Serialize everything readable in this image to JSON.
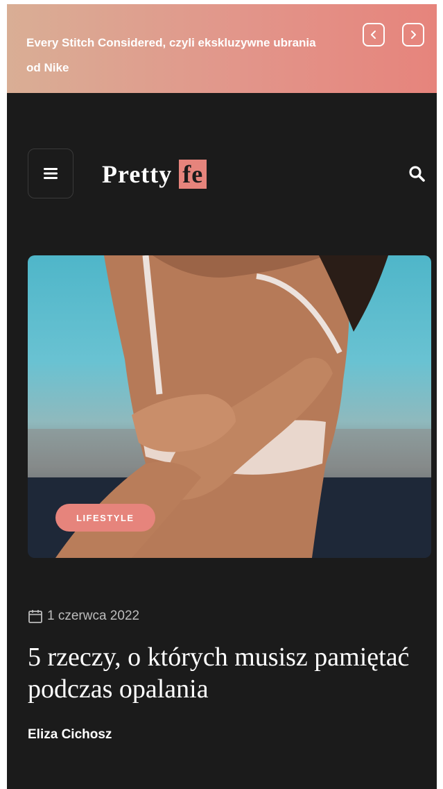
{
  "ticker": {
    "headline": "Every Stitch Considered, czyli ekskluzywne ubrania od Nike",
    "prev_icon": "chevron-left-icon",
    "next_icon": "chevron-right-icon"
  },
  "header": {
    "menu_icon": "hamburger-menu-icon",
    "logo_main": "Pretty",
    "logo_accent": "fe",
    "search_icon": "search-icon"
  },
  "post": {
    "image_alt": "woman in white swimsuit by the pool",
    "category": "LIFESTYLE",
    "date": "1 czerwca 2022",
    "date_icon": "calendar-icon",
    "title": "5 rzeczy, o których musisz pamiętać podczas opalania",
    "author": "Eliza Cichosz"
  },
  "colors": {
    "accent": "#e6847c",
    "background": "#1b1b1b",
    "ticker_gradient_start": "#d9ae95",
    "ticker_gradient_end": "#e6847c"
  }
}
